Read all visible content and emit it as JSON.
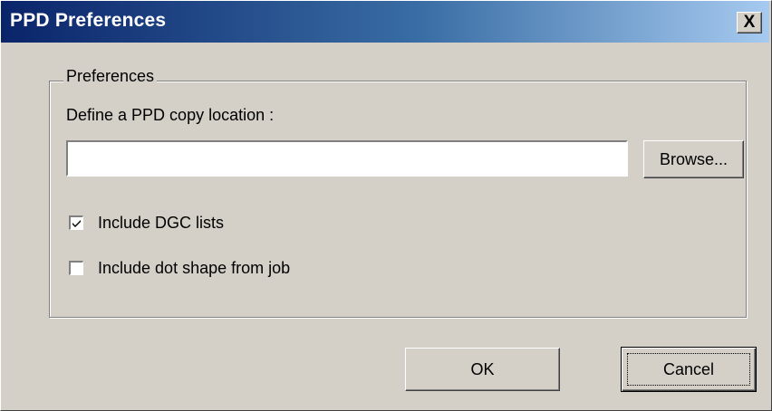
{
  "window": {
    "title": "PPD Preferences",
    "close_label": "X"
  },
  "preferences": {
    "group_label": "Preferences",
    "copy_location_label": "Define a PPD copy location :",
    "copy_location_value": "",
    "browse_label": "Browse...",
    "checkboxes": [
      {
        "label": "Include DGC lists",
        "checked": true
      },
      {
        "label": "Include dot shape from job",
        "checked": false
      }
    ]
  },
  "buttons": {
    "ok_label": "OK",
    "cancel_label": "Cancel"
  }
}
